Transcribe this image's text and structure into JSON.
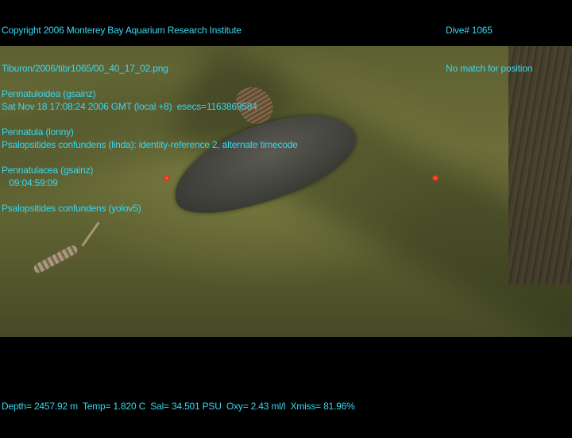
{
  "header": {
    "copyright": "Copyright 2006 Monterey Bay Aquarium Research Institute",
    "file_path": "Tiburon/2006/tibr1065/00_40_17_02.png",
    "datetime": "Sat Nov 18 17:08:24 2006 GMT (local +8)  esecs=1163869584",
    "annotation": "Psalopsitides confundens (linda): identity-reference 2, alternate timecode",
    "timecode": "   09:04:59:09"
  },
  "dive": {
    "dive_number": "Dive# 1065",
    "position_status": "No match for position"
  },
  "labels": [
    "Pennatuloidea (gsainz)",
    "Pennatula (lonny)",
    "Pennatulacea (gsainz)",
    "Psalopsitides confundens (yolov5)"
  ],
  "footer": {
    "telemetry": "Depth= 2457.92 m  Temp= 1.820 C  Sal= 34.501 PSU  Oxy= 2.43 ml/l  Xmiss= 81.96%"
  },
  "colors": {
    "overlay_text": "#38d8f0",
    "laser": "#e0301a",
    "seafloor": "#6b6e38"
  }
}
